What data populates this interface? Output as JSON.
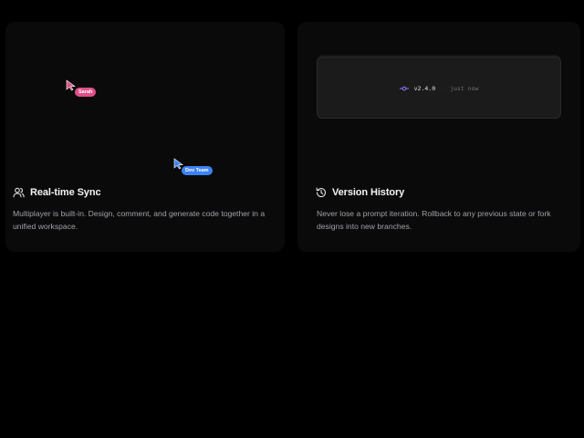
{
  "cards": [
    {
      "title": "Real-time Sync",
      "icon": "users-icon",
      "description": "Multiplayer is built-in. Design, comment, and generate code together in a unified workspace.",
      "cursors": [
        {
          "label": "Sarah",
          "color": "#e0508a"
        },
        {
          "label": "Dev Team",
          "color": "#3b82f6"
        }
      ]
    },
    {
      "title": "Version History",
      "icon": "history-icon",
      "description": "Never lose a prompt iteration. Rollback to any previous state or fork designs into new branches.",
      "version": {
        "tag": "v2.4.0",
        "separator": "·",
        "time": "just now",
        "icon": "git-commit-icon",
        "accent": "#8b7cf6"
      }
    }
  ]
}
